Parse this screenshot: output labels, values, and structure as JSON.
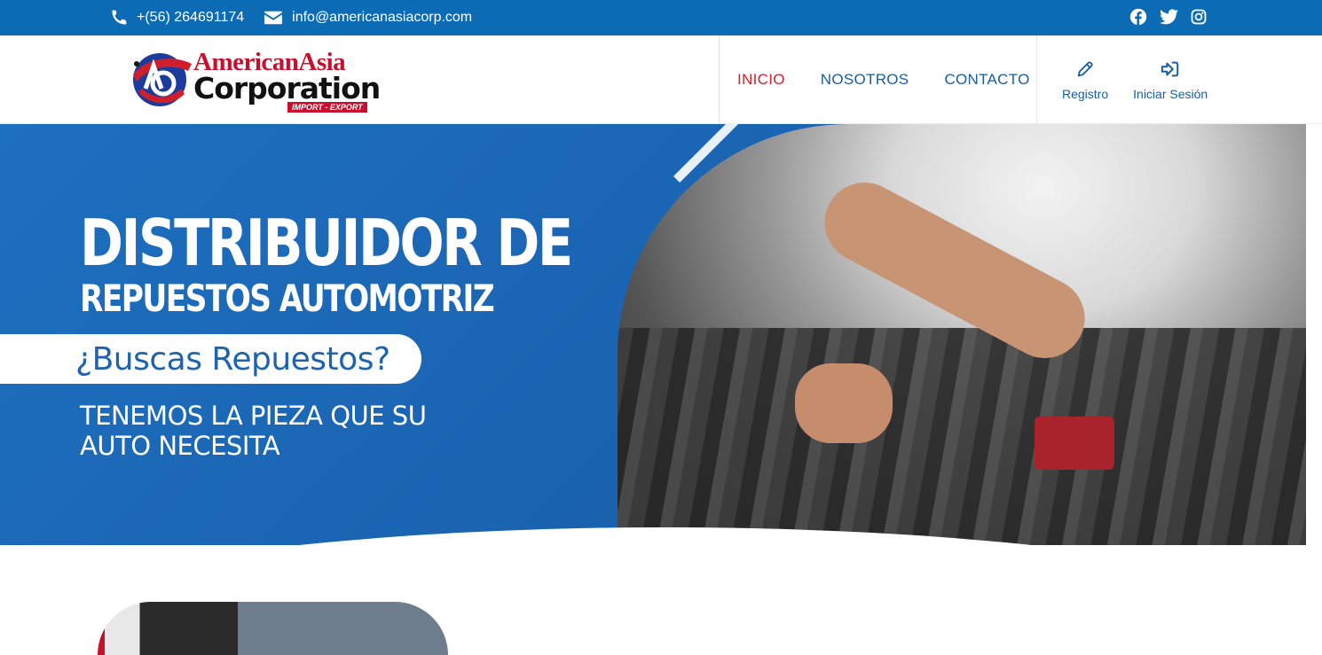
{
  "topbar": {
    "phone": "+(56) 264691174",
    "email": "info@americanasiacorp.com",
    "social": [
      "facebook-icon",
      "twitter-icon",
      "instagram-icon"
    ]
  },
  "logo": {
    "line1": "AmericanAsia",
    "line2": "Corporation",
    "tag": "IMPORT - EXPORT"
  },
  "nav": {
    "items": [
      {
        "label": "INICIO",
        "active": true
      },
      {
        "label": "NOSOTROS",
        "active": false
      },
      {
        "label": "CONTACTO",
        "active": false
      }
    ]
  },
  "actions": {
    "register": "Registro",
    "login": "Iniciar Sesión"
  },
  "hero": {
    "title": "DISTRIBUIDOR DE",
    "subtitle": "REPUESTOS AUTOMOTRIZ",
    "question": "¿Buscas Repuestos?",
    "tagline_line1": "TENEMOS LA PIEZA QUE SU",
    "tagline_line2": "AUTO NECESITA"
  },
  "colors": {
    "topbar": "#0b6cb5",
    "accent_red": "#d22030",
    "nav_blue": "#1a5d9e",
    "hero_blue": "#1d6fc0"
  }
}
